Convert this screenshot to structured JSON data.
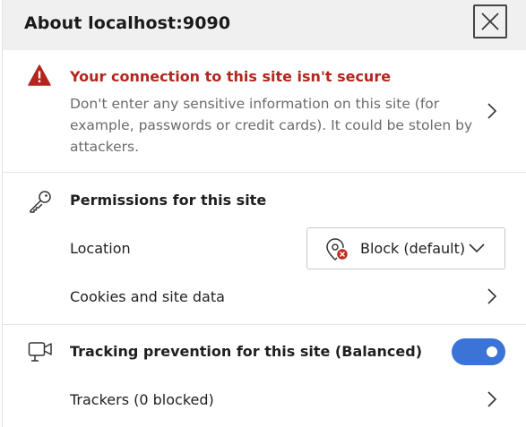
{
  "header": {
    "title": "About localhost:9090",
    "close_icon": "close-icon"
  },
  "security_warning": {
    "title": "Your connection to this site isn't secure",
    "description": "Don't enter any sensitive information on this site (for example, passwords or credit cards). It could be stolen by attackers.",
    "icon": "warning-triangle-icon",
    "color": "#b3261e"
  },
  "permissions": {
    "title": "Permissions for this site",
    "icon": "key-icon",
    "location": {
      "label": "Location",
      "value": "Block (default)",
      "icon": "location-blocked-icon"
    },
    "cookies": {
      "label": "Cookies and site data"
    }
  },
  "tracking": {
    "title": "Tracking prevention for this site (Balanced)",
    "icon": "camera-icon",
    "toggle_on": true,
    "toggle_color": "#3b73d6",
    "trackers": {
      "label": "Trackers (0 blocked)"
    }
  }
}
